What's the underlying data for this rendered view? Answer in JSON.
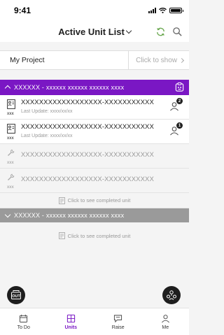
{
  "status_bar": {
    "time": "9:41"
  },
  "header": {
    "title": "Active Unit List"
  },
  "project": {
    "name": "My Project",
    "show_label": "Click to show"
  },
  "groups": [
    {
      "title": "XXXXXX - xxxxxx xxxxxx xxxxxx xxxx",
      "expanded": true,
      "units": [
        {
          "name": "XXXXXXXXXXXXXXXXXX-XXXXXXXXXXX",
          "code": "xxx",
          "update": "Last Update: xxxx/xx/xx",
          "badge": "2",
          "active": true
        },
        {
          "name": "XXXXXXXXXXXXXXXXXX-XXXXXXXXXXX",
          "code": "xxx",
          "update": "Last Update: xxxx/xx/xx",
          "badge": "1",
          "active": true
        },
        {
          "name": "XXXXXXXXXXXXXXXXXX-XXXXXXXXXXX",
          "code": "xxx",
          "active": false
        },
        {
          "name": "XXXXXXXXXXXXXXXXXX-XXXXXXXXXXX",
          "code": "xxx",
          "active": false
        }
      ],
      "completed_label": "Click to see completed unit"
    },
    {
      "title": "XXXXXX - xxxxxx xxxxxx xxxxxx xxxx",
      "expanded": false,
      "completed_label": "Click to see completed unit"
    }
  ],
  "fab_left": {
    "label": "OUT",
    "icon": "checkout-icon"
  },
  "fab_right": {
    "icon": "team-icon"
  },
  "tabs": [
    {
      "label": "To Do",
      "icon": "todo-icon",
      "active": false
    },
    {
      "label": "Units",
      "icon": "units-icon",
      "active": true
    },
    {
      "label": "Raise",
      "icon": "raise-icon",
      "active": false
    },
    {
      "label": "Me",
      "icon": "person-icon",
      "active": false
    }
  ],
  "colors": {
    "accent": "#7a17c4",
    "collapsed_group": "#9a9a9a",
    "fab": "#1e1e1e"
  }
}
